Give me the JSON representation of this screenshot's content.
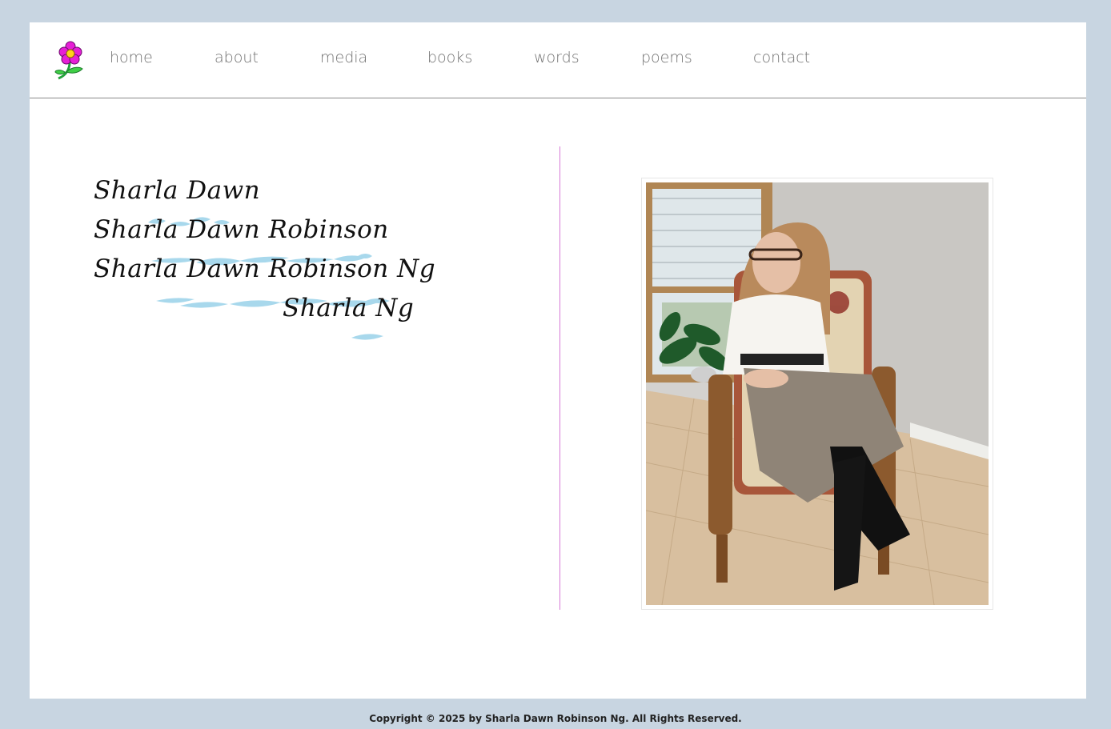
{
  "nav": {
    "items": [
      {
        "label": "home"
      },
      {
        "label": "about"
      },
      {
        "label": "media"
      },
      {
        "label": "books"
      },
      {
        "label": "words"
      },
      {
        "label": "poems"
      },
      {
        "label": "contact"
      }
    ]
  },
  "names": {
    "line1": "Sharla  Dawn",
    "line2": "Sharla  Dawn Robinson",
    "line3": "Sharla  Dawn Robinson Ng",
    "line4": "Sharla Ng"
  },
  "footer": {
    "copyright": "Copyright © 2025 by Sharla Dawn Robinson Ng. All Rights Reserved."
  },
  "colors": {
    "background": "#c8d5e1",
    "divider": "#d77ad6",
    "nav_text": "#707070",
    "wash": "#9fd4ea",
    "flower": "#e61fd6"
  },
  "icons": {
    "logo": "flower-icon"
  }
}
